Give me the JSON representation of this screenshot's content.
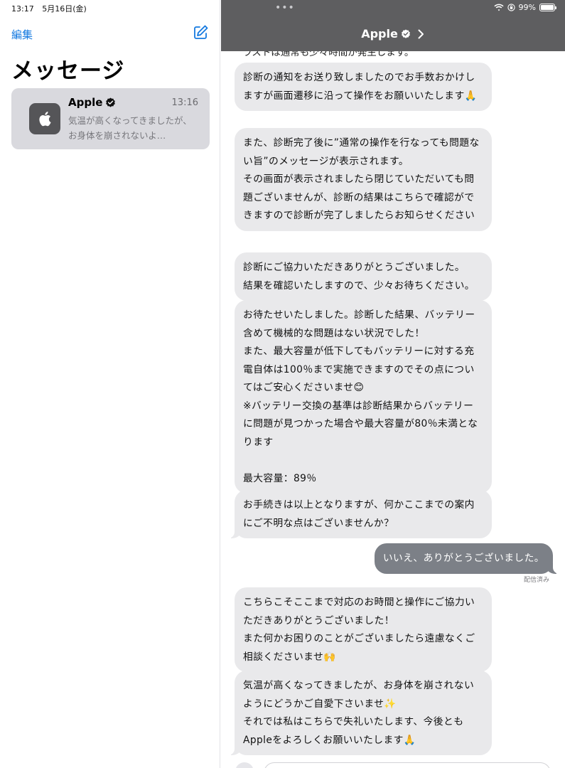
{
  "status_bar": {
    "time": "13:17",
    "date": "5月16日(金)",
    "battery": "99%"
  },
  "sidebar": {
    "edit_label": "編集",
    "title": "メッセージ",
    "conversations": [
      {
        "name": "Apple",
        "time": "13:16",
        "preview": "気温が高くなってきましたが、お身体を崩されないよ…"
      }
    ]
  },
  "chat": {
    "contact_name": "Apple",
    "cut_off_text": "ラストは通常も少々時間が発生します。",
    "messages": [
      {
        "from": "them",
        "text": "診断の通知をお送り致しましたのでお手数おかけしますが画面遷移に沿って操作をお願いいたします🙏"
      },
      {
        "from": "them",
        "text": "また、診断完了後に”通常の操作を行なっても問題ない旨”のメッセージが表示されます。\nその画面が表示されましたら閉じていただいても問題ございませんが、診断の結果はこちらで確認ができますので診断が完了しましたらお知らせください"
      },
      {
        "from": "them",
        "text": "診断にご協力いただきありがとうございました。\n結果を確認いたしますので、少々お待ちください。"
      },
      {
        "from": "them",
        "text": "お待たせいたしました。診断した結果、バッテリー含めて機械的な問題はない状況でした！\nまた、最大容量が低下してもバッテリーに対する充電自体は100％まで実施できますのでその点についてはご安心くださいませ😊\n※バッテリー交換の基準は診断結果からバッテリーに問題が見つかった場合や最大容量が80％未満となります\n\n最大容量：89％"
      },
      {
        "from": "them",
        "text": "お手続きは以上となりますが、何かここまでの案内にご不明な点はございませんか？"
      },
      {
        "from": "me",
        "text": "いいえ、ありがとうございました。"
      },
      {
        "from": "them",
        "text": "こちらこそここまで対応のお時間と操作にご協力いただきありがとうございました！\nまた何かお困りのことがございましたら遠慮なくご相談くださいませ🙌"
      },
      {
        "from": "them",
        "text": "気温が高くなってきましたが、お身体を崩されないようにどうかご自愛下さいませ✨\nそれでは私はこちらで失礼いたします、今後ともAppleをよろしくお願いいたします🙏"
      }
    ],
    "delivered_label": "配信済み"
  },
  "colors": {
    "accent": "#1479e0",
    "header_bg": "#5e5e60",
    "incoming_bubble": "#e9e9eb",
    "outgoing_bubble": "#7c8087"
  },
  "icons": {
    "compose": "compose-icon",
    "verified": "verified-badge-icon",
    "chevron": "chevron-right-icon",
    "wifi": "wifi-icon",
    "battery": "battery-icon",
    "apple_logo": "apple-logo-icon"
  }
}
